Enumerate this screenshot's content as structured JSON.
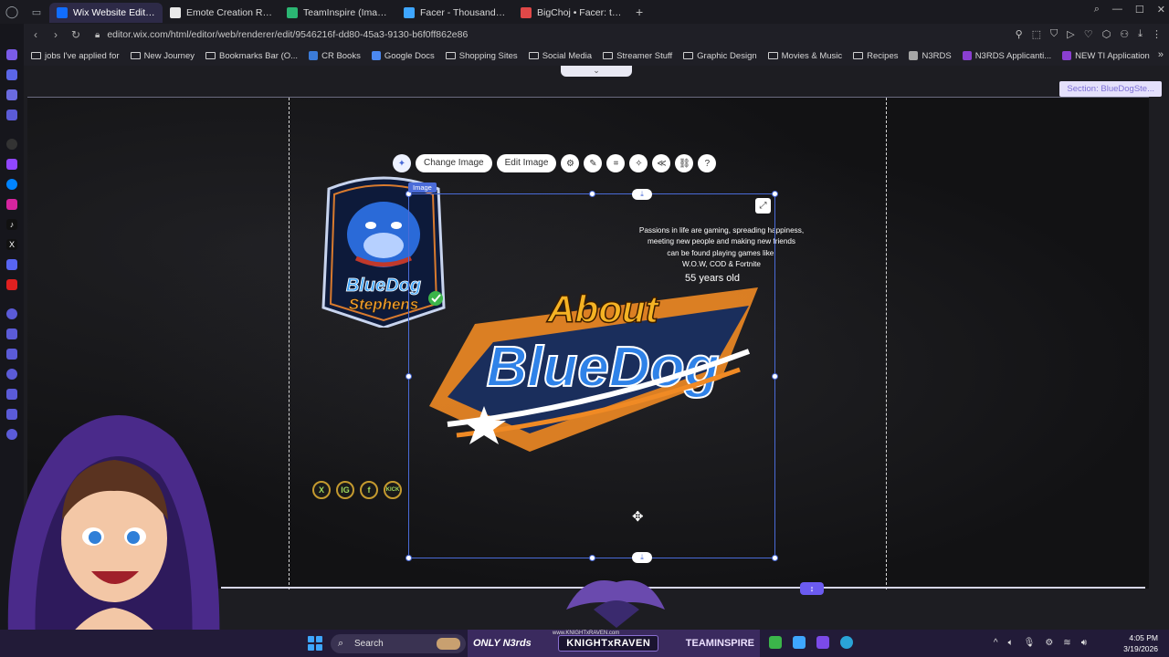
{
  "browser": {
    "tabs": [
      {
        "title": "Wix Website Editor | Team",
        "active": true,
        "favicon_color": "#116dff"
      },
      {
        "title": "Emote Creation Request",
        "active": false,
        "favicon_color": "#e9e9e9"
      },
      {
        "title": "TeamInspire (Images, Pos",
        "active": false,
        "favicon_color": "#2bb673"
      },
      {
        "title": "Facer - Thousands of FRE",
        "active": false,
        "favicon_color": "#3ea6ff"
      },
      {
        "title": "BigChoj • Facer: the world",
        "active": false,
        "favicon_color": "#e04848"
      }
    ],
    "url": "editor.wix.com/html/editor/web/renderer/edit/9546216f-dd80-45a3-9130-b6f0ff862e86"
  },
  "bookmarks": [
    {
      "label": "jobs I've applied for",
      "type": "folder"
    },
    {
      "label": "New Journey",
      "type": "folder"
    },
    {
      "label": "Bookmarks Bar (O...",
      "type": "folder"
    },
    {
      "label": "CR Books",
      "type": "link",
      "color": "#3b7bd8"
    },
    {
      "label": "Google Docs",
      "type": "link",
      "color": "#4b88f0"
    },
    {
      "label": "Shopping Sites",
      "type": "folder"
    },
    {
      "label": "Social Media",
      "type": "folder"
    },
    {
      "label": "Streamer Stuff",
      "type": "folder"
    },
    {
      "label": "Graphic Design",
      "type": "folder"
    },
    {
      "label": "Movies & Music",
      "type": "folder"
    },
    {
      "label": "Recipes",
      "type": "folder"
    },
    {
      "label": "N3RDS",
      "type": "link",
      "color": "#a6a6a6"
    },
    {
      "label": "N3RDS Applicanti...",
      "type": "link",
      "color": "#8a3fd1"
    },
    {
      "label": "NEW TI Application",
      "type": "link",
      "color": "#8a3fd1"
    }
  ],
  "editor": {
    "section_label": "Section: BlueDogSte...",
    "image_tag": "Image",
    "toolbar": {
      "change_image": "Change Image",
      "edit_image": "Edit Image"
    },
    "about": {
      "line1": "Passions in life are gaming, spreading happiness,",
      "line2": "meeting new people and making new friends",
      "line3": "can be found playing games like:",
      "line4": "W.O.W, COD & Fortnite",
      "age": "55 years old"
    },
    "banner": {
      "word1": "About",
      "word2": "BlueDog"
    },
    "badge": {
      "line1": "BlueDog",
      "line2": "Stephens"
    },
    "socials": [
      "X",
      "IG",
      "f",
      "KICK"
    ]
  },
  "taskbar": {
    "search_placeholder": "Search",
    "brand_only": "ONLY N3rds",
    "brand_kr": "KNIGHTxRAVEN",
    "brand_kr_small": "www.KNIGHTxRAVEN.com",
    "brand_ti": "TEAMINSPIRE",
    "time": "4:05 PM",
    "date": "3/19/2026"
  },
  "colors": {
    "accent": "#4a6bd8",
    "section_label_bg": "#e4e0fb",
    "taskbar_bg": "#221b38",
    "tab_active_bg": "#2d2a47"
  }
}
